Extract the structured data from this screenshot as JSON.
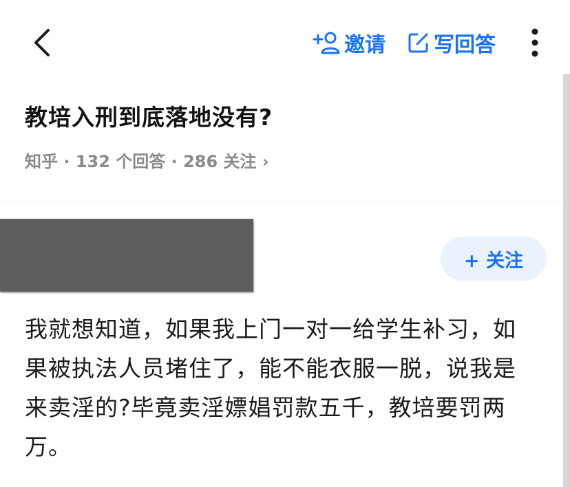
{
  "header": {
    "invite_label": "邀请",
    "write_answer_label": "写回答"
  },
  "question": {
    "title": "教培入刑到底落地没有?",
    "meta": "知乎 · 132 个回答 · 286 关注 ›"
  },
  "answer": {
    "follow_label": "+ 关注",
    "body": "我就想知道，如果我上门一对一给学生补习，如果被执法人员堵住了，能不能衣服一脱，说我是来卖淫的?毕竟卖淫嫖娼罚款五千，教培要罚两万。"
  },
  "icons": {
    "back": "chevron-left-icon",
    "invite": "add-user-icon",
    "write": "edit-icon",
    "more": "more-vertical-icon"
  },
  "colors": {
    "accent": "#1772f6",
    "follow_bg": "#eaf2fd",
    "meta_text": "#8a8a8a",
    "redaction": "#5d5d5f"
  }
}
